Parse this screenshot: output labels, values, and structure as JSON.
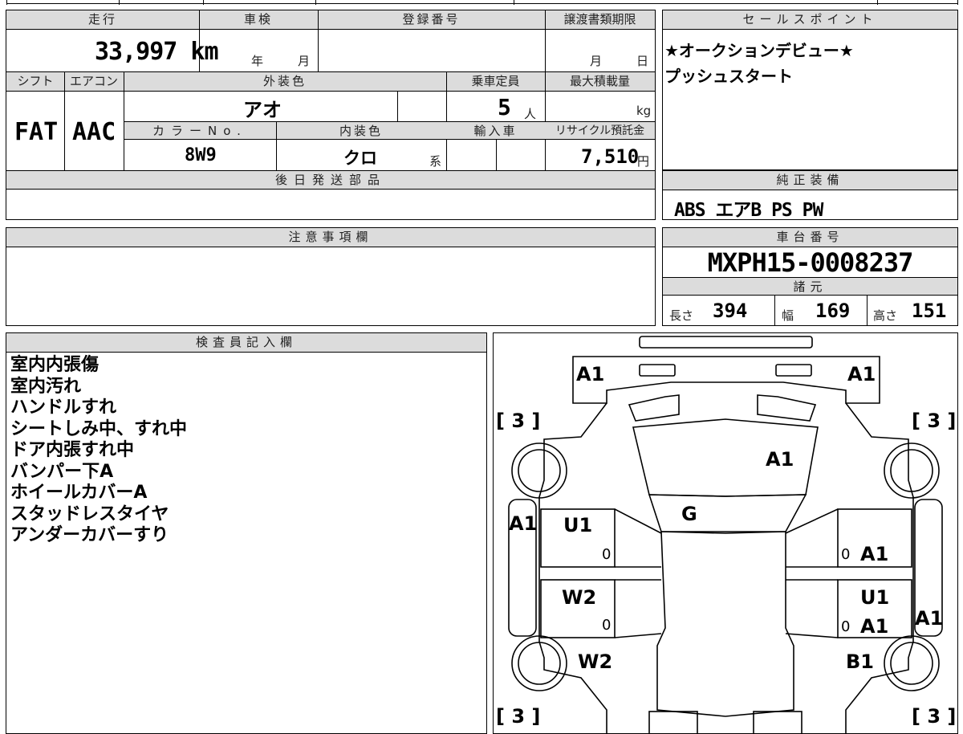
{
  "header": {
    "mileage_label": "走行",
    "mileage_value": "33,997 km",
    "inspection_label": "車検",
    "inspection_year": "年",
    "inspection_month": "月",
    "registration_label": "登録番号",
    "transfer_deadline_label": "譲渡書類期限",
    "transfer_month": "月",
    "transfer_day": "日",
    "shift_label": "シフト",
    "shift_value": "FAT",
    "aircon_label": "エアコン",
    "aircon_value": "AAC",
    "exterior_color_label": "外装色",
    "exterior_color_value": "アオ",
    "capacity_label": "乗車定員",
    "capacity_value": "5",
    "capacity_unit": "人",
    "max_load_label": "最大積載量",
    "max_load_unit": "kg",
    "color_no_label": "カラーNo.",
    "color_no_value": "8W9",
    "interior_color_label": "内装色",
    "interior_color_value": "クロ",
    "interior_color_suffix": "系",
    "import_label": "輸入車",
    "recycle_label": "リサイクル預託金",
    "recycle_value": "7,510",
    "recycle_unit": "円",
    "later_parts_label": "後日発送部品"
  },
  "sales_point": {
    "label": "セールスポイント",
    "lines": [
      "★オークションデビュー★",
      "プッシュスタート"
    ]
  },
  "genuine_equipment": {
    "label": "純正装備",
    "value": "ABS エアB PS PW"
  },
  "caution": {
    "label": "注意事項欄"
  },
  "chassis": {
    "label": "車台番号",
    "value": "MXPH15-0008237",
    "spec_label": "諸元",
    "length_label": "長さ",
    "length_value": "394",
    "width_label": "幅",
    "width_value": "169",
    "height_label": "高さ",
    "height_value": "151"
  },
  "inspector": {
    "label": "検査員記入欄",
    "notes": [
      "室内内張傷",
      "室内汚れ",
      "ハンドルすれ",
      "シートしみ中、すれ中",
      "ドア内張すれ中",
      "バンパー下A",
      "ホイールカバーA",
      "スタッドレスタイヤ",
      "アンダーカバーすり"
    ]
  },
  "diagram": {
    "marks": {
      "front_left": "A1",
      "front_right": "A1",
      "tire_fl": "[ 3 ]",
      "tire_fr": "[ 3 ]",
      "tire_rl": "[ 3 ]",
      "tire_rr": "[ 3 ]",
      "windshield": "A1",
      "roof": "G",
      "left_fender": "A1",
      "front_left_door": "U1",
      "rear_left_door": "W2",
      "rear_left_quarter": "W2",
      "front_right_door": "A1",
      "rear_right_door_u": "U1",
      "rear_right_door_a": "A1",
      "right_side": "A1",
      "rear_right_quarter": "B1",
      "zero": "0"
    }
  }
}
